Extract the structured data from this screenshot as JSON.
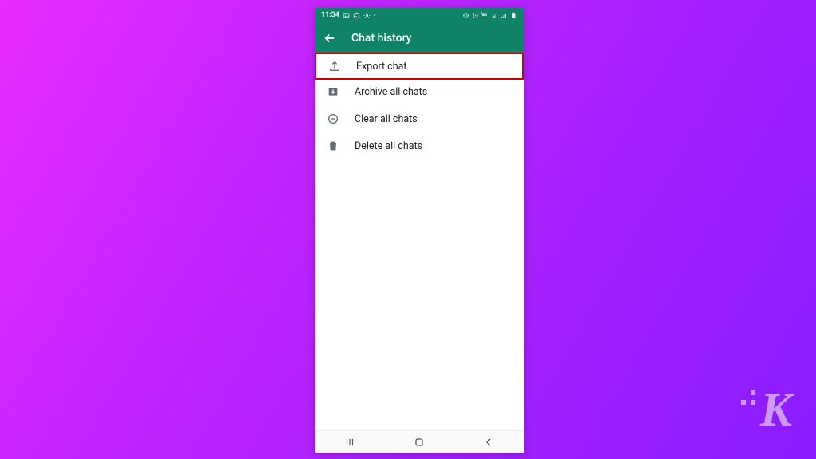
{
  "statusbar": {
    "time": "11:34",
    "left_icons": [
      "image-icon",
      "whatsapp-icon",
      "settings-gear-icon",
      "dot-icon"
    ],
    "right_icons": [
      "vibrate-icon",
      "alarm-icon",
      "vowifi-icon",
      "signal-icon",
      "signal-icon",
      "battery-icon"
    ]
  },
  "appbar": {
    "title": "Chat history"
  },
  "items": [
    {
      "icon": "upload-icon",
      "label": "Export chat",
      "highlighted": true
    },
    {
      "icon": "archive-icon",
      "label": "Archive all chats",
      "highlighted": false
    },
    {
      "icon": "clear-circle-icon",
      "label": "Clear all chats",
      "highlighted": false
    },
    {
      "icon": "trash-icon",
      "label": "Delete all chats",
      "highlighted": false
    }
  ],
  "navbar": {
    "recents": "|||",
    "home": "○",
    "back": "‹"
  },
  "watermark": {
    "letter": "K"
  },
  "colors": {
    "brand": "#0f8367",
    "highlight": "#d00000"
  }
}
